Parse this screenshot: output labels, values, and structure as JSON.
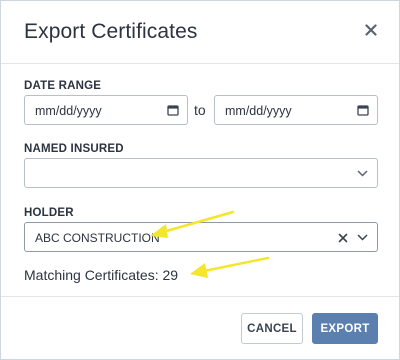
{
  "dialog": {
    "title": "Export Certificates",
    "close_icon": "close-icon"
  },
  "date_range": {
    "label": "DATE RANGE",
    "from_placeholder": "mm/dd/yyyy",
    "to_text": "to",
    "to_placeholder": "mm/dd/yyyy",
    "icon": "calendar-icon"
  },
  "named_insured": {
    "label": "NAMED INSURED",
    "value": ""
  },
  "holder": {
    "label": "HOLDER",
    "value": "ABC CONSTRUCTION"
  },
  "matching": {
    "text": "Matching Certificates: 29"
  },
  "footer": {
    "cancel_label": "CANCEL",
    "export_label": "EXPORT"
  },
  "colors": {
    "accent": "#5b7fae",
    "annotation_arrow": "#f4e62a"
  }
}
